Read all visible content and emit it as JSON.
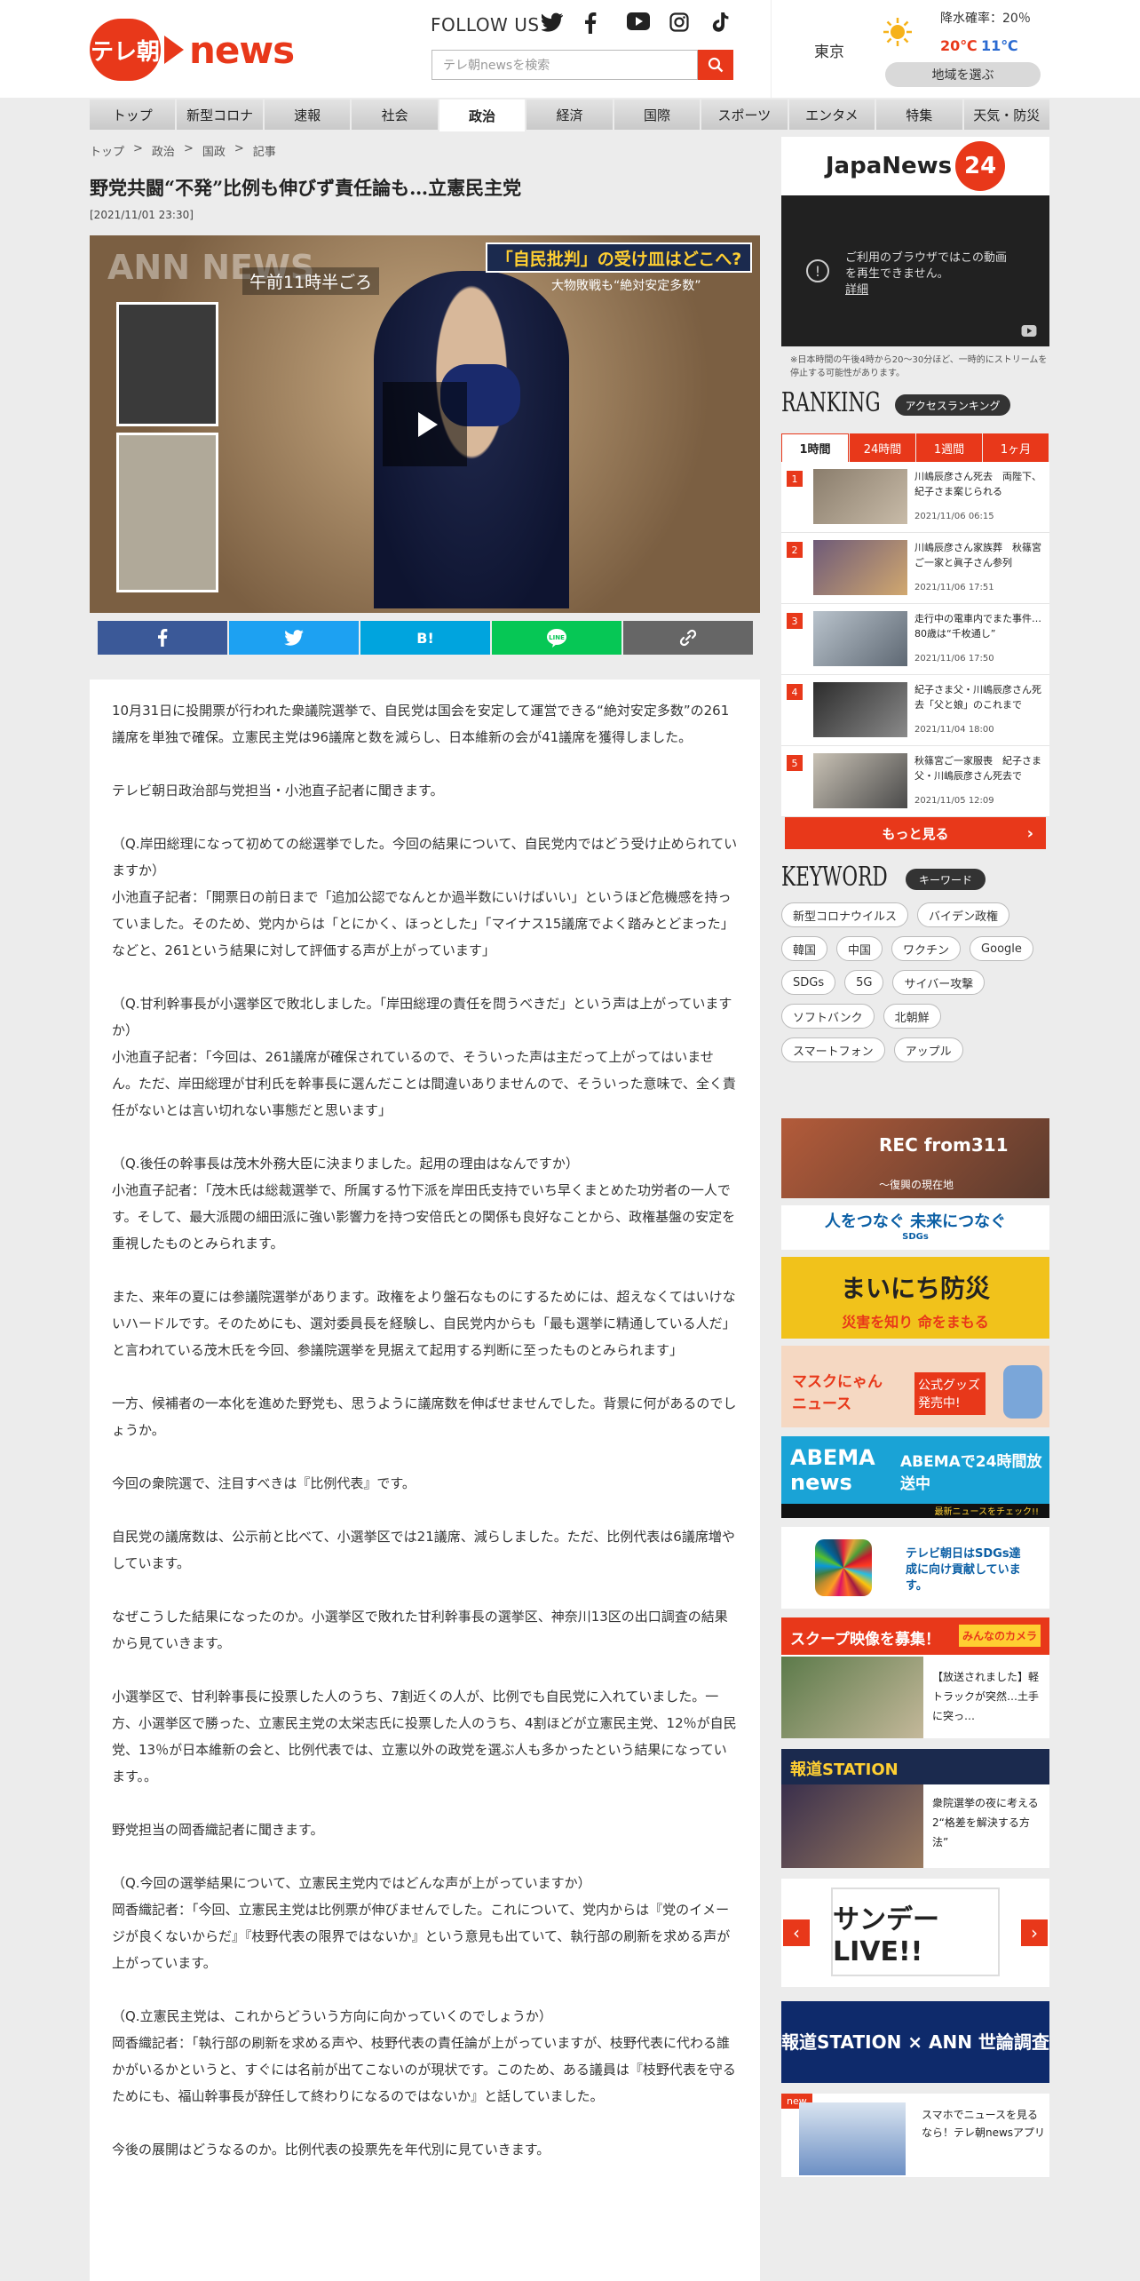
{
  "header": {
    "logo_badge": "テレ朝",
    "logo_text": "news",
    "follow_label": "FOLLOW US",
    "search_placeholder": "テレ朝newsを検索",
    "social_icons": [
      "twitter-icon",
      "facebook-icon",
      "youtube-icon",
      "instagram-icon",
      "tiktok-icon"
    ]
  },
  "weather": {
    "city": "東京",
    "rain_label": "降水確率：20％",
    "high": "20℃",
    "low": "11℃",
    "region_button": "地域を選ぶ"
  },
  "nav": {
    "items": [
      {
        "label": "トップ"
      },
      {
        "label": "新型コロナ"
      },
      {
        "label": "速報"
      },
      {
        "label": "社会"
      },
      {
        "label": "政治"
      },
      {
        "label": "経済"
      },
      {
        "label": "国際"
      },
      {
        "label": "スポーツ"
      },
      {
        "label": "エンタメ"
      },
      {
        "label": "特集"
      },
      {
        "label": "天気・防災"
      }
    ],
    "active": "政治"
  },
  "breadcrumb": [
    "トップ",
    "政治",
    "国政",
    "記事"
  ],
  "article": {
    "title": "野党共闘“不発”比例も伸びず責任論も…立憲民主党",
    "date": "[2021/11/01 23:30]",
    "video": {
      "time_label": "午前11時半ごろ",
      "caption": "「自民批判」の受け皿はどこへ?",
      "caption_sub": "大物敗戦も“絶対安定多数”",
      "watermark": "ANN NEWS"
    },
    "share": {
      "bookmark": "B!"
    },
    "paragraphs": [
      "10月31日に投開票が行われた衆議院選挙で、自民党は国会を安定して運営できる“絶対安定多数”の261議席を単独で確保。立憲民主党は96議席と数を減らし、日本維新の会が41議席を獲得しました。",
      "テレビ朝日政治部与党担当・小池直子記者に聞きます。",
      "（Q.岸田総理になって初めての総選挙でした。今回の結果について、自民党内ではどう受け止められていますか）\n小池直子記者：「開票日の前日まで「追加公認でなんとか過半数にいけばいい」というほど危機感を持っていました。そのため、党内からは「とにかく、ほっとした」「マイナス15議席でよく踏みとどまった」などと、261という結果に対して評価する声が上がっています」",
      "（Q.甘利幹事長が小選挙区で敗北しました。「岸田総理の責任を問うべきだ」という声は上がっていますか）\n小池直子記者：「今回は、261議席が確保されているので、そういった声は主だって上がってはいません。ただ、岸田総理が甘利氏を幹事長に選んだことは間違いありませんので、そういった意味で、全く責任がないとは言い切れない事態だと思います」",
      "（Q.後任の幹事長は茂木外務大臣に決まりました。起用の理由はなんですか）\n小池直子記者：「茂木氏は総裁選挙で、所属する竹下派を岸田氏支持でいち早くまとめた功労者の一人です。そして、最大派閥の細田派に強い影響力を持つ安倍氏との関係も良好なことから、政権基盤の安定を重視したものとみられます。",
      "また、来年の夏には参議院選挙があります。政権をより盤石なものにするためには、超えなくてはいけないハードルです。そのためにも、選対委員長を経験し、自民党内からも「最も選挙に精通している人だ」と言われている茂木氏を今回、参議院選挙を見据えて起用する判断に至ったものとみられます」",
      "一方、候補者の一本化を進めた野党も、思うように議席数を伸ばせませんでした。背景に何があるのでしょうか。",
      "今回の衆院選で、注目すべきは『比例代表』です。",
      "自民党の議席数は、公示前と比べて、小選挙区では21議席、減らしました。ただ、比例代表は6議席増やしています。",
      "なぜこうした結果になったのか。小選挙区で敗れた甘利幹事長の選挙区、神奈川13区の出口調査の結果から見ていきます。",
      "小選挙区で、甘利幹事長に投票した人のうち、7割近くの人が、比例でも自民党に入れていました。一方、小選挙区で勝った、立憲民主党の太栄志氏に投票した人のうち、4割ほどが立憲民主党、12％が自民党、13％が日本維新の会と、比例代表では、立憲以外の政党を選ぶ人も多かったという結果になっています。。",
      "野党担当の岡香織記者に聞きます。",
      "（Q.今回の選挙結果について、立憲民主党内ではどんな声が上がっていますか）\n岡香織記者：「今回、立憲民主党は比例票が伸びませんでした。これについて、党内からは『党のイメージが良くないからだ』『枝野代表の限界ではないか』という意見も出ていて、執行部の刷新を求める声が上がっています。",
      "（Q.立憲民主党は、これからどういう方向に向かっていくのでしょうか）\n岡香織記者：「執行部の刷新を求める声や、枝野代表の責任論が上がっていますが、枝野代表に代わる誰かがいるかというと、すぐには名前が出てこないのが現状です。このため、ある議員は『枝野代表を守るためにも、福山幹事長が辞任して終わりになるのではないか』と話していました。",
      "今後の展開はどうなるのか。比例代表の投票先を年代別に見ていきます。"
    ]
  },
  "sidebar": {
    "japanews": {
      "name": "JapaNews",
      "num": "24"
    },
    "video_error": "ご利用のブラウザではこの動画\nを再生できません。",
    "video_error_link": "詳細",
    "video_note": "※日本時間の午後4時から20～30分ほど、一時的にストリームを停止する可能性があります。",
    "ranking_title": "RANKING",
    "ranking_badge": "アクセスランキング",
    "ranking_tabs": [
      "1時間",
      "24時間",
      "1週間",
      "1ヶ月"
    ],
    "ranking_items": [
      {
        "num": "1",
        "text": "川嶋辰彦さん死去　両陛下、紀子さま案じられる",
        "date": "2021/11/06 06:15"
      },
      {
        "num": "2",
        "text": "川嶋辰彦さん家族葬　秋篠宮ご一家と眞子さん参列",
        "date": "2021/11/06 17:51"
      },
      {
        "num": "3",
        "text": "走行中の電車内でまた事件…80歳は“千枚通し”",
        "date": "2021/11/06 17:50"
      },
      {
        "num": "4",
        "text": "紀子さま父・川嶋辰彦さん死去「父と娘」のこれまで",
        "date": "2021/11/04 18:00"
      },
      {
        "num": "5",
        "text": "秋篠宮ご一家服喪　紀子さま父・川嶋辰彦さん死去で",
        "date": "2021/11/05 12:09"
      }
    ],
    "more_label": "もっと見る",
    "keyword_title": "KEYWORD",
    "keyword_badge": "キーワード",
    "keywords": [
      "新型コロナウイルス",
      "バイデン政権",
      "韓国",
      "中国",
      "ワクチン",
      "Google",
      "SDGs",
      "5G",
      "サイバー攻撃",
      "ソフトバンク",
      "北朝鮮",
      "スマートフォン",
      "アップル"
    ],
    "banners": {
      "rec": "REC from311",
      "rec_sub": "～復興の現在地",
      "sdgs": "人をつなぐ 未来につなぐ",
      "sdgs_sub": "SDGs",
      "bosai": "まいにち防災",
      "bosai_sub": "災害を知り 命をまもる",
      "mask": "マスクにゃん ニュース",
      "mask_sub": "公式グッズ発売中!",
      "abema": "ABEMA news",
      "abema_sub": "ABEMAで24時間放送中",
      "abema_sub2": "最新ニュースをチェック!!",
      "sdgs2": "テレビ朝日はSDGs達成に向け貢献しています。",
      "scoop": "スクープ映像を募集！",
      "scoop_tag": "みんなのカメラ",
      "scoop_text": "【放送されました】軽トラックが突然…土手に突っ…",
      "hodo": "報道STATION",
      "hodo_text": "衆院選挙の夜に考える2“格差を解決する方法”",
      "sunday": "サンデーLIVE!!",
      "poll": "報道STATION × ANN 世論調査",
      "app_new": "new",
      "app_text": "スマホでニュースを見るなら！テレ朝newsアプリ"
    }
  }
}
